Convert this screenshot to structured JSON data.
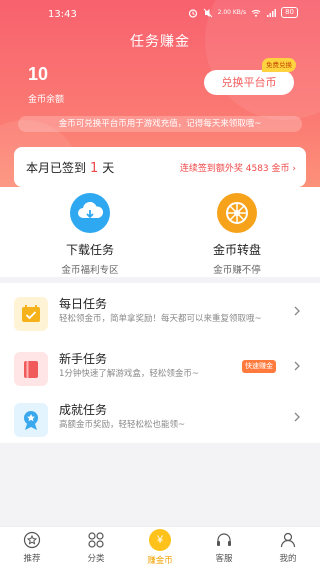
{
  "status_bar": {
    "time": "13:43",
    "network": "2.00 KB/s",
    "battery": "80"
  },
  "header": {
    "title": "任务赚金"
  },
  "coins": {
    "amount": "10",
    "label": "金币余额"
  },
  "exchange": {
    "label": "兑换平台币",
    "tag": "免费兑换"
  },
  "notice": "金币可兑换平台币用于游戏充值，记得每天来领取哦~",
  "signin": {
    "prefix": "本月已签到",
    "days": "1",
    "suffix": "天",
    "bonus": "连续签到额外奖 4583 金币",
    "chevron": "›"
  },
  "quick_actions": [
    {
      "title": "下载任务",
      "subtitle": "金币福利专区",
      "icon": "cloud-download-icon",
      "color": "#2ea8f0"
    },
    {
      "title": "金币转盘",
      "subtitle": "金币赚不停",
      "icon": "wheel-icon",
      "color": "#f7a21b"
    }
  ],
  "tasks": [
    {
      "title": "每日任务",
      "desc": "轻松领金币，简单拿奖励！每天都可以来重复领取哦~",
      "icon": "calendar-icon",
      "icon_bg": "#fff3d6",
      "icon_color": "#f6b21a"
    },
    {
      "title": "新手任务",
      "desc": "1分钟快速了解游戏盒，轻松领金币~",
      "tag": "快速赚金",
      "icon": "book-icon",
      "icon_bg": "#ffe5e5",
      "icon_color": "#f05a5a"
    },
    {
      "title": "成就任务",
      "desc": "高额金币奖励，轻轻松松也能领~",
      "icon": "medal-icon",
      "icon_bg": "#e3f4ff",
      "icon_color": "#39a8ec"
    }
  ],
  "tabbar": {
    "items": [
      {
        "label": "推荐",
        "icon": "star-icon"
      },
      {
        "label": "分类",
        "icon": "grid-icon"
      },
      {
        "label": "赚金币",
        "icon": "yen-coin-icon",
        "glyph": "¥",
        "active": true
      },
      {
        "label": "客服",
        "icon": "headset-icon"
      },
      {
        "label": "我的",
        "icon": "user-icon"
      }
    ]
  },
  "colors": {
    "accent_red": "#f45c5c",
    "accent_gold": "#ffc21a",
    "gradient_top": "#f8616e",
    "gradient_bottom": "#fd9a7c"
  }
}
